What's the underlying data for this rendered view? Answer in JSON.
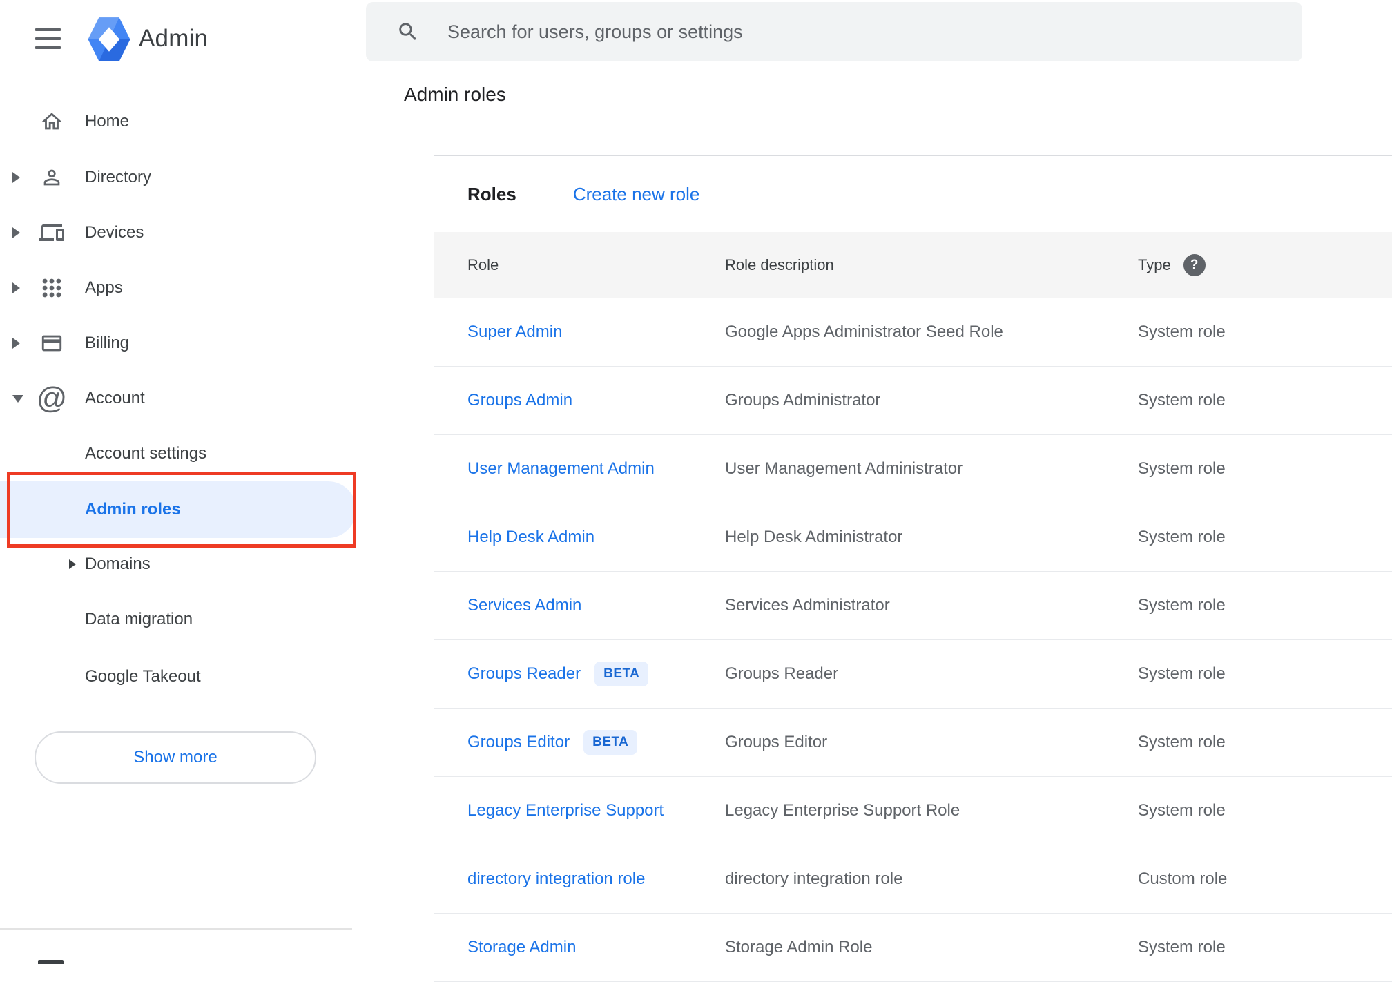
{
  "app": {
    "logo_text": "Admin"
  },
  "search": {
    "placeholder": "Search for users, groups or settings"
  },
  "page": {
    "title": "Admin roles"
  },
  "sidebar": {
    "items": [
      {
        "label": "Home"
      },
      {
        "label": "Directory"
      },
      {
        "label": "Devices"
      },
      {
        "label": "Apps"
      },
      {
        "label": "Billing"
      },
      {
        "label": "Account"
      }
    ],
    "account_children": [
      {
        "label": "Account settings"
      },
      {
        "label": "Admin roles"
      },
      {
        "label": "Domains"
      },
      {
        "label": "Data migration"
      },
      {
        "label": "Google Takeout"
      }
    ],
    "show_more_label": "Show more"
  },
  "roles_panel": {
    "heading": "Roles",
    "create_link_label": "Create new role",
    "columns": [
      "Role",
      "Role description",
      "Type"
    ],
    "beta_label": "BETA",
    "rows": [
      {
        "role": "Super Admin",
        "description": "Google Apps Administrator Seed Role",
        "type": "System role",
        "beta": false
      },
      {
        "role": "Groups Admin",
        "description": "Groups Administrator",
        "type": "System role",
        "beta": false
      },
      {
        "role": "User Management Admin",
        "description": "User Management Administrator",
        "type": "System role",
        "beta": false
      },
      {
        "role": "Help Desk Admin",
        "description": "Help Desk Administrator",
        "type": "System role",
        "beta": false
      },
      {
        "role": "Services Admin",
        "description": "Services Administrator",
        "type": "System role",
        "beta": false
      },
      {
        "role": "Groups Reader",
        "description": "Groups Reader",
        "type": "System role",
        "beta": true
      },
      {
        "role": "Groups Editor",
        "description": "Groups Editor",
        "type": "System role",
        "beta": true
      },
      {
        "role": "Legacy Enterprise Support",
        "description": "Legacy Enterprise Support Role",
        "type": "System role",
        "beta": false
      },
      {
        "role": "directory integration role",
        "description": "directory integration role",
        "type": "Custom role",
        "beta": false
      },
      {
        "role": "Storage Admin",
        "description": "Storage Admin Role",
        "type": "System role",
        "beta": false
      }
    ]
  },
  "colors": {
    "accent_blue": "#1a73e8",
    "selected_pill_bg": "#e8f0fe",
    "annotation_red": "#ee3b24",
    "beta_text": "#1967d2",
    "beta_bg": "#e8f0fe",
    "header_row_bg": "#f5f5f5"
  }
}
